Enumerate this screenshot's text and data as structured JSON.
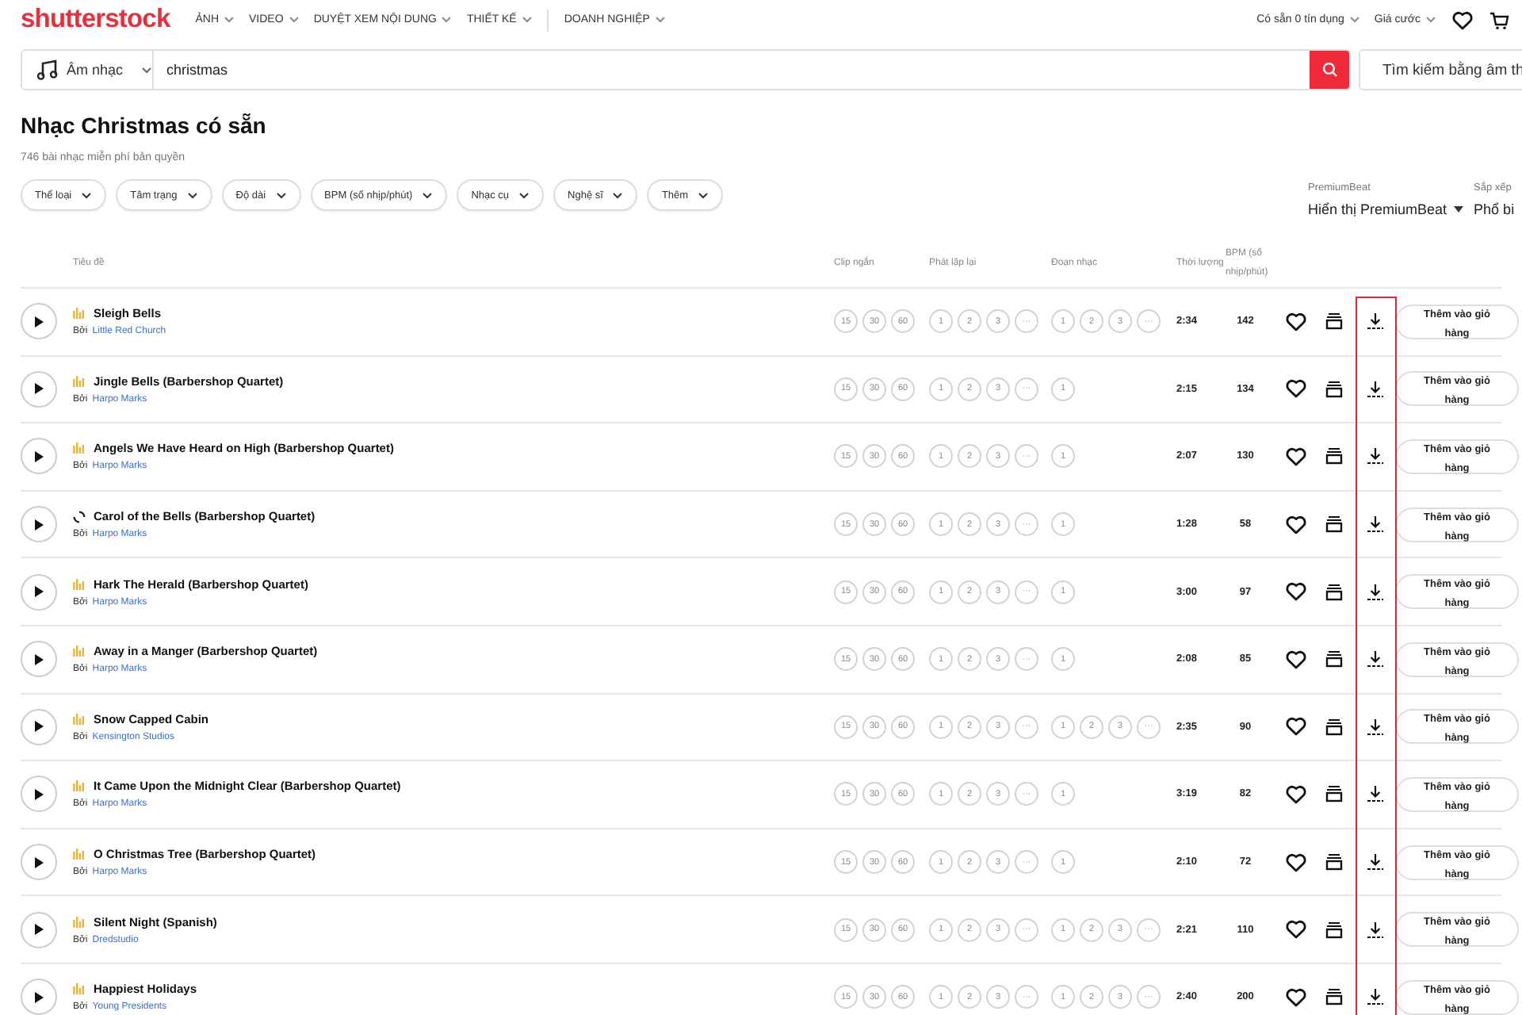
{
  "nav": {
    "logo": "shutterstock",
    "menu": [
      {
        "label": "ẢNH"
      },
      {
        "label": "VIDEO"
      },
      {
        "label": "DUYỆT XEM NỘI DUNG"
      },
      {
        "label": "THIẾT KẾ"
      },
      {
        "label": "DOANH NGHIỆP"
      }
    ],
    "account": [
      {
        "label": "Có sẵn 0 tín dụng"
      },
      {
        "label": "Giá cước"
      }
    ]
  },
  "search": {
    "category": "Âm nhạc",
    "query": "christmas",
    "audio_search": "Tìm kiếm bằng âm th"
  },
  "heading": {
    "title": "Nhạc Christmas có sẵn",
    "subtitle": "746 bài nhạc miễn phí bản quyền"
  },
  "filters": [
    "Thể loại",
    "Tâm trạng",
    "Độ dài",
    "BPM (số nhịp/phút)",
    "Nhạc cụ",
    "Nghệ sĩ",
    "Thêm"
  ],
  "premiumbeat": {
    "label": "PremiumBeat",
    "value": "Hiển thị PremiumBeat"
  },
  "sort": {
    "label": "Sắp xếp",
    "value": "Phổ bi"
  },
  "table": {
    "columns": [
      "Tiêu đề",
      "Clip ngắn",
      "Phát lặp lại",
      "Đoạn nhạc",
      "Thời lượng",
      "BPM (số nhịp/phút)"
    ],
    "rows": [
      {
        "title": "Sleigh Bells",
        "by": "Bởi",
        "artist": "Little Red Church",
        "loading": false,
        "clips": [
          "15",
          "30",
          "60"
        ],
        "loops": [
          "1",
          "2",
          "3",
          "···"
        ],
        "segments": [
          "1",
          "2",
          "3",
          "···"
        ],
        "duration": "2:34",
        "bpm": "142",
        "cart_button": "Thêm vào giỏ hàng"
      },
      {
        "title": "Jingle Bells (Barbershop Quartet)",
        "by": "Bởi",
        "artist": "Harpo Marks",
        "loading": false,
        "clips": [
          "15",
          "30",
          "60"
        ],
        "loops": [
          "1",
          "2",
          "3",
          "···"
        ],
        "segments": [
          "1"
        ],
        "duration": "2:15",
        "bpm": "134",
        "cart_button": "Thêm vào giỏ hàng"
      },
      {
        "title": "Angels We Have Heard on High (Barbershop Quartet)",
        "by": "Bởi",
        "artist": "Harpo Marks",
        "loading": false,
        "clips": [
          "15",
          "30",
          "60"
        ],
        "loops": [
          "1",
          "2",
          "3",
          "···"
        ],
        "segments": [
          "1"
        ],
        "duration": "2:07",
        "bpm": "130",
        "cart_button": "Thêm vào giỏ hàng"
      },
      {
        "title": "Carol of the Bells (Barbershop Quartet)",
        "by": "Bởi",
        "artist": "Harpo Marks",
        "loading": true,
        "clips": [
          "15",
          "30",
          "60"
        ],
        "loops": [
          "1",
          "2",
          "3",
          "···"
        ],
        "segments": [
          "1"
        ],
        "duration": "1:28",
        "bpm": "58",
        "cart_button": "Thêm vào giỏ hàng"
      },
      {
        "title": "Hark The Herald (Barbershop Quartet)",
        "by": "Bởi",
        "artist": "Harpo Marks",
        "loading": false,
        "clips": [
          "15",
          "30",
          "60"
        ],
        "loops": [
          "1",
          "2",
          "3",
          "···"
        ],
        "segments": [
          "1"
        ],
        "duration": "3:00",
        "bpm": "97",
        "cart_button": "Thêm vào giỏ hàng"
      },
      {
        "title": "Away in a Manger (Barbershop Quartet)",
        "by": "Bởi",
        "artist": "Harpo Marks",
        "loading": false,
        "clips": [
          "15",
          "30",
          "60"
        ],
        "loops": [
          "1",
          "2",
          "3",
          "···"
        ],
        "segments": [
          "1"
        ],
        "duration": "2:08",
        "bpm": "85",
        "cart_button": "Thêm vào giỏ hàng"
      },
      {
        "title": "Snow Capped Cabin",
        "by": "Bởi",
        "artist": "Kensington Studios",
        "loading": false,
        "clips": [
          "15",
          "30",
          "60"
        ],
        "loops": [
          "1",
          "2",
          "3",
          "···"
        ],
        "segments": [
          "1",
          "2",
          "3",
          "···"
        ],
        "duration": "2:35",
        "bpm": "90",
        "cart_button": "Thêm vào giỏ hàng"
      },
      {
        "title": "It Came Upon the Midnight Clear (Barbershop Quartet)",
        "by": "Bởi",
        "artist": "Harpo Marks",
        "loading": false,
        "clips": [
          "15",
          "30",
          "60"
        ],
        "loops": [
          "1",
          "2",
          "3",
          "···"
        ],
        "segments": [
          "1"
        ],
        "duration": "3:19",
        "bpm": "82",
        "cart_button": "Thêm vào giỏ hàng"
      },
      {
        "title": "O Christmas Tree (Barbershop Quartet)",
        "by": "Bởi",
        "artist": "Harpo Marks",
        "loading": false,
        "clips": [
          "15",
          "30",
          "60"
        ],
        "loops": [
          "1",
          "2",
          "3",
          "···"
        ],
        "segments": [
          "1"
        ],
        "duration": "2:10",
        "bpm": "72",
        "cart_button": "Thêm vào giỏ hàng"
      },
      {
        "title": "Silent Night (Spanish)",
        "by": "Bởi",
        "artist": "Dredstudio",
        "loading": false,
        "clips": [
          "15",
          "30",
          "60"
        ],
        "loops": [
          "1",
          "2",
          "3",
          "···"
        ],
        "segments": [
          "1",
          "2",
          "3",
          "···"
        ],
        "duration": "2:21",
        "bpm": "110",
        "cart_button": "Thêm vào giỏ hàng"
      },
      {
        "title": "Happiest Holidays",
        "by": "Bởi",
        "artist": "Young Presidents",
        "loading": false,
        "clips": [
          "15",
          "30",
          "60"
        ],
        "loops": [
          "1",
          "2",
          "3",
          "···"
        ],
        "segments": [
          "1",
          "2",
          "3",
          "···"
        ],
        "duration": "2:40",
        "bpm": "200",
        "cart_button": "Thêm vào giỏ hàng"
      }
    ]
  },
  "highlight_download_column": true
}
